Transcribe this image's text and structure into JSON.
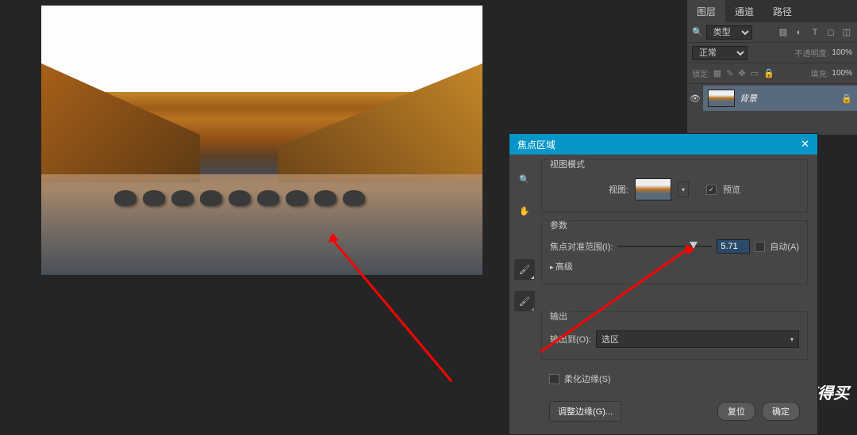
{
  "layersPanel": {
    "tabs": [
      "图层",
      "通道",
      "路径"
    ],
    "filterType": "类型",
    "filterIcons": [
      "image-icon",
      "adjust-icon",
      "text-icon",
      "shape-icon",
      "smart-icon"
    ],
    "blendMode": "正常",
    "opacityLabel": "不透明度:",
    "opacityValue": "100%",
    "lockLabel": "锁定:",
    "fillLabel": "填充:",
    "fillValue": "100%",
    "layer": {
      "name": "背景"
    }
  },
  "dialog": {
    "title": "焦点区域",
    "viewModeLabel": "视图模式",
    "viewLabel": "视图:",
    "previewLabel": "预览",
    "previewChecked": true,
    "paramsLabel": "参数",
    "focusRangeLabel": "焦点对准范围(I):",
    "focusRangeValue": "5.71",
    "autoLabel": "自动(A)",
    "autoChecked": false,
    "advancedLabel": "高级",
    "outputLabel": "输出",
    "outputToLabel": "输出到(O):",
    "outputValue": "选区",
    "softenEdgesLabel": "柔化边缘(S)",
    "softenChecked": false,
    "refineEdgeLabel": "调整边缘(G)...",
    "resetLabel": "复位",
    "okLabel": "确定"
  },
  "watermark": "什么值得买"
}
